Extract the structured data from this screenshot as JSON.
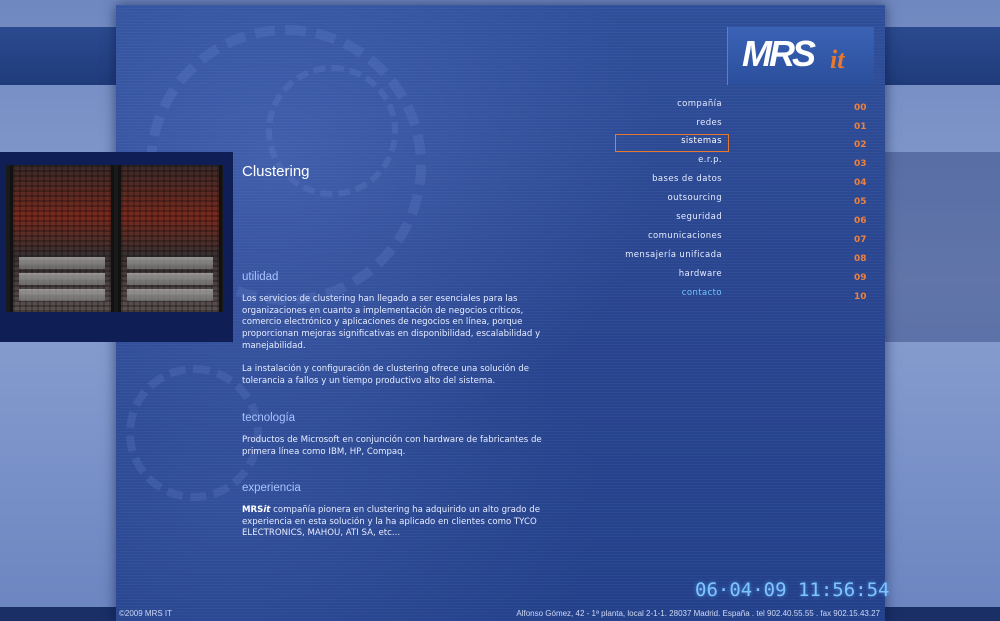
{
  "brand": {
    "logo_main": "MRS",
    "logo_accent": "it"
  },
  "colors": {
    "accent": "#e8782e",
    "heading": "#a9c3ff",
    "contact_link": "#6fc3ff",
    "panel": "#2a4690"
  },
  "image": {
    "icon": "server-rack-photo"
  },
  "main": {
    "title": "Clustering",
    "sections": [
      {
        "heading": "utilidad",
        "paragraphs": [
          "Los servicios de clustering han llegado a ser esenciales para las organizaciones en cuanto a implementación de negocios críticos, comercio electrónico y aplicaciones de negocios en línea, porque proporcionan mejoras significativas en disponibilidad, escalabilidad y manejabilidad.",
          "La instalación y configuración de clustering ofrece una solución de tolerancia a fallos y un tiempo productivo alto del sistema."
        ]
      },
      {
        "heading": "tecnología",
        "paragraphs": [
          "Productos de Microsoft en conjunción con hardware de fabricantes de primera línea como IBM, HP, Compaq."
        ]
      },
      {
        "heading": "experiencia",
        "brand_main": "MRS",
        "brand_accent": "it",
        "paragraph_rest": " compañía pionera en clustering ha adquirido un alto grado de experiencia en esta solución y la ha aplicado en clientes como TYCO ELECTRONICS, MAHOU, ATI SA,  etc..."
      }
    ]
  },
  "nav": {
    "items": [
      {
        "label": "compañía",
        "num": "00"
      },
      {
        "label": "redes",
        "num": "01"
      },
      {
        "label": "sistemas",
        "num": "02",
        "active": true
      },
      {
        "label": "e.r.p.",
        "num": "03"
      },
      {
        "label": "bases de datos",
        "num": "04"
      },
      {
        "label": "outsourcing",
        "num": "05"
      },
      {
        "label": "seguridad",
        "num": "06"
      },
      {
        "label": "comunicaciones",
        "num": "07"
      },
      {
        "label": "mensajería unificada",
        "num": "08"
      },
      {
        "label": "hardware",
        "num": "09"
      },
      {
        "label": "contacto",
        "num": "10"
      }
    ]
  },
  "clock": "06·04·09  11:56:54",
  "footer": {
    "copyright": "©2009  MRS IT",
    "address": "Alfonso Gómez, 42 - 1ª planta, local 2-1-1. 28037 Madrid. España . tel 902.40.55.55 . fax 902.15.43.27"
  }
}
